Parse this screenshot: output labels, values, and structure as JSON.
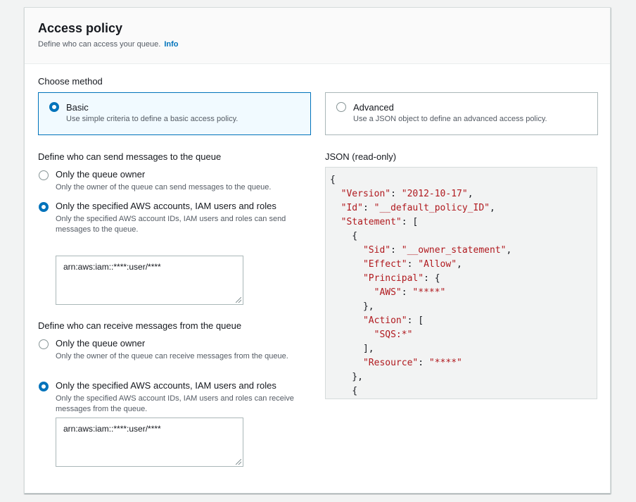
{
  "header": {
    "title": "Access policy",
    "description": "Define who can access your queue.",
    "info_link": "Info"
  },
  "method": {
    "label": "Choose method",
    "basic": {
      "title": "Basic",
      "description": "Use simple criteria to define a basic access policy.",
      "selected": true
    },
    "advanced": {
      "title": "Advanced",
      "description": "Use a JSON object to define an advanced access policy.",
      "selected": false
    }
  },
  "send": {
    "label": "Define who can send messages to the queue",
    "owner_title": "Only the queue owner",
    "owner_desc": "Only the owner of the queue can send messages to the queue.",
    "specified_title": "Only the specified AWS accounts, IAM users and roles",
    "specified_desc": "Only the specified AWS account IDs, IAM users and roles can send messages to the queue.",
    "selected": "specified",
    "textarea_value": "arn:aws:iam::****:user/****"
  },
  "receive": {
    "label": "Define who can receive messages from the queue",
    "owner_title": "Only the queue owner",
    "owner_desc": "Only the owner of the queue can receive messages from the queue.",
    "specified_title": "Only the specified AWS accounts, IAM users and roles",
    "specified_desc": "Only the specified AWS account IDs, IAM users and roles can receive messages from the queue.",
    "selected": "specified",
    "textarea_value": "arn:aws:iam::****:user/****"
  },
  "json_panel": {
    "label": "JSON (read-only)",
    "lines": [
      "{",
      "  \"Version\": \"2012-10-17\",",
      "  \"Id\": \"__default_policy_ID\",",
      "  \"Statement\": [",
      "    {",
      "      \"Sid\": \"__owner_statement\",",
      "      \"Effect\": \"Allow\",",
      "      \"Principal\": {",
      "        \"AWS\": \"****\"",
      "      },",
      "      \"Action\": [",
      "        \"SQS:*\"",
      "      ],",
      "      \"Resource\": \"****\"",
      "    },",
      "    {"
    ]
  },
  "colors": {
    "accent": "#0073bb",
    "json_string": "#b0191e"
  }
}
